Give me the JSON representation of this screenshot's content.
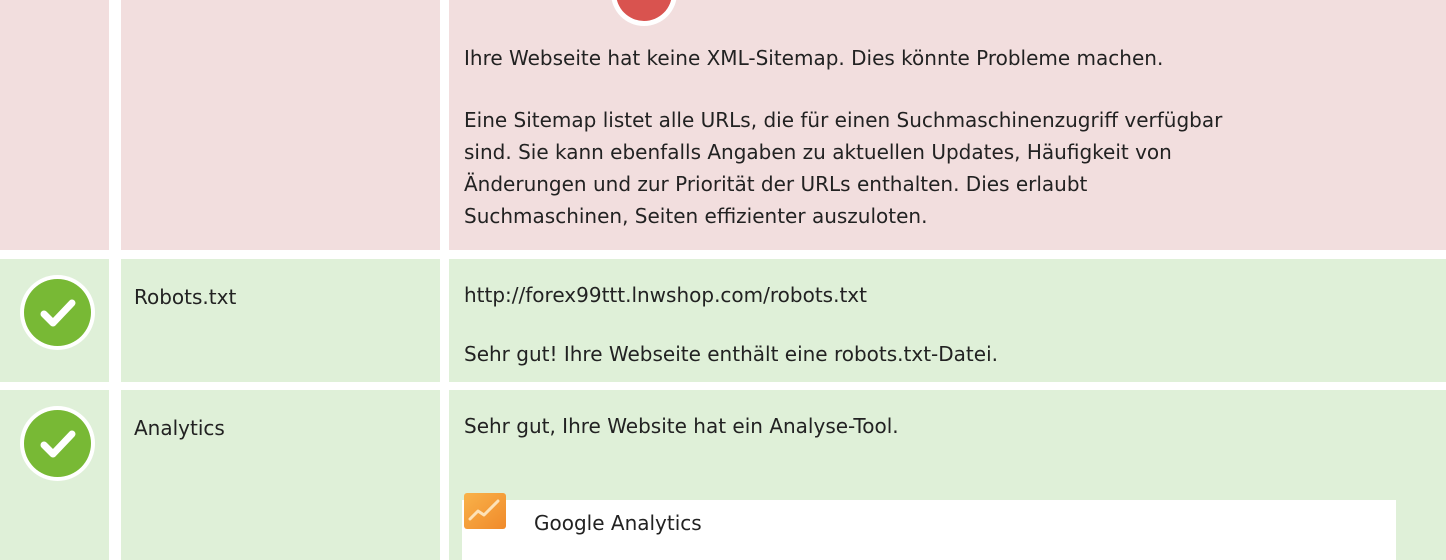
{
  "sitemap": {
    "status": "error",
    "message": "Ihre Webseite hat keine XML-Sitemap. Dies könnte Probleme machen.",
    "description": "Eine Sitemap listet alle URLs, die für einen Suchmaschinenzugriff verfügbar sind. Sie kann ebenfalls Angaben zu aktuellen Updates, Häufigkeit von Änderungen und zur Priorität der URLs enthalten. Dies erlaubt Suchmaschinen, Seiten effizienter auszuloten."
  },
  "robots": {
    "status": "success",
    "label": "Robots.txt",
    "url": "http://forex99ttt.lnwshop.com/robots.txt",
    "message": "Sehr gut! Ihre Webseite enthält eine robots.txt-Datei."
  },
  "analytics": {
    "status": "success",
    "label": "Analytics",
    "message": "Sehr gut, Ihre Website hat ein Analyse-Tool.",
    "tool_name": "Google Analytics",
    "tool_icon": "analytics-icon"
  },
  "colors": {
    "error_bg": "#f2dede",
    "success_bg": "#dff0d8",
    "check_green": "#78b935",
    "error_red": "#d9534f",
    "ga_orange": "#f6a23a"
  }
}
